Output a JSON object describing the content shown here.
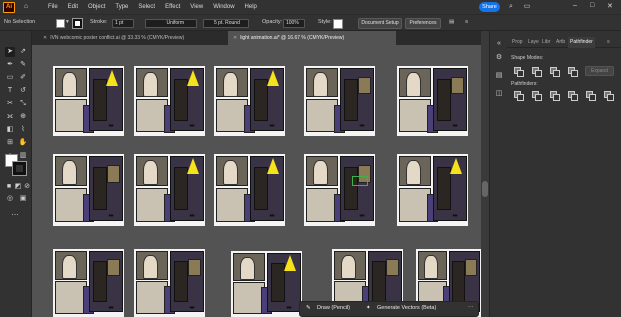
{
  "app": {
    "logo": "Ai"
  },
  "menu": {
    "items": [
      "File",
      "Edit",
      "Object",
      "Type",
      "Select",
      "Effect",
      "View",
      "Window",
      "Help"
    ]
  },
  "topright": {
    "share_label": "Share"
  },
  "control": {
    "selection_label": "No Selection",
    "stroke_label": "Stroke:",
    "stroke_value": "1 pt",
    "profile_value": "Uniform",
    "brush_value": "5 pt. Round",
    "opacity_label": "Opacity:",
    "opacity_value": "100%",
    "style_label": "Style:",
    "doc_setup_label": "Document Setup",
    "preferences_label": "Preferences"
  },
  "tabs": [
    {
      "label": "IVN webcomic poster conflict.ai @ 33.33 % (CMYK/Preview)",
      "active": false
    },
    {
      "label": "light animation.ai* @ 16.67 % (CMYK/Preview)",
      "active": true
    }
  ],
  "rightpanel": {
    "tabs": [
      "Prop",
      "Laye",
      "Libr",
      "Artb",
      "Pathfinder"
    ],
    "shape_modes_label": "Shape Modes:",
    "expand_label": "Expand",
    "pathfinders_label": "Pathfinders:"
  },
  "genbar": {
    "draw_label": "Draw (Pencil)",
    "generate_label": "Generate Vectors (Beta)"
  },
  "colors": {
    "accent": "#1473e6",
    "lamp": "#f5e21a",
    "selection": "#3fb14c"
  }
}
